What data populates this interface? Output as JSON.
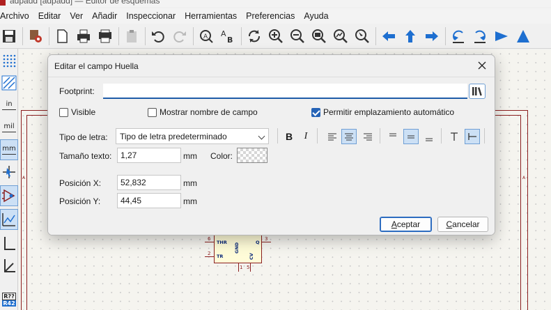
{
  "window": {
    "title": "adpadd [adpadd] — Editor de esquemas"
  },
  "menu": [
    "Archivo",
    "Editar",
    "Ver",
    "Añadir",
    "Inspeccionar",
    "Herramientas",
    "Preferencias",
    "Ayuda"
  ],
  "left_toolbar": {
    "units_in": "in",
    "units_mil": "mil",
    "units_mm": "mm",
    "annotate": "R??",
    "annotate2": "R42"
  },
  "schematic": {
    "component": {
      "pin_thr": "THR",
      "pin_tr": "TR",
      "pin_q": "Q",
      "pin_gnd": "GND",
      "pin_cv": "CV",
      "num_6": "6",
      "num_2": "2",
      "num_3": "3",
      "num_1": "1",
      "num_5": "5"
    },
    "frame_letter_a": "A"
  },
  "dialog": {
    "title": "Editar el campo Huella",
    "footprint_label": "Footprint:",
    "footprint_value": "",
    "visible_label": "Visible",
    "visible_checked": false,
    "show_field_name_label": "Mostrar nombre de campo",
    "show_field_name_checked": false,
    "auto_place_label": "Permitir emplazamiento automático",
    "auto_place_checked": true,
    "font_label": "Tipo de letra:",
    "font_value": "Tipo de letra predeterminado",
    "bold": "B",
    "italic": "I",
    "text_size_label": "Tamaño texto:",
    "text_size_value": "1,27",
    "text_size_unit": "mm",
    "color_label": "Color:",
    "pos_x_label": "Posición X:",
    "pos_x_value": "52,832",
    "pos_x_unit": "mm",
    "pos_y_label": "Posición Y:",
    "pos_y_value": "44,45",
    "pos_y_unit": "mm",
    "ok_prefix": "",
    "ok_mnemonic": "A",
    "ok_rest": "ceptar",
    "cancel_mnemonic": "C",
    "cancel_rest": "ancelar"
  },
  "colors": {
    "accent": "#2563b6",
    "frame": "#8b1e1e",
    "toolbar_blue": "#1e6fd0"
  }
}
